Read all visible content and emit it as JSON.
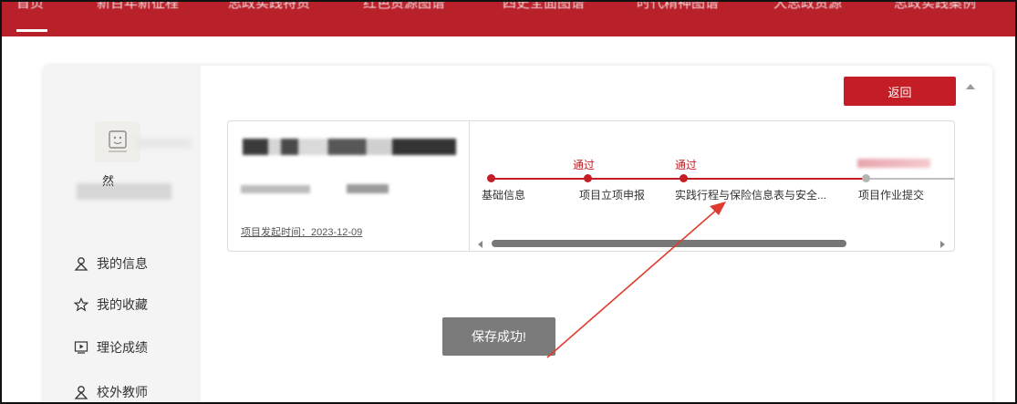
{
  "nav": {
    "items": [
      "首页",
      "新百年新征程",
      "思政实践特资",
      "红色资源图谱",
      "四史全面图谱",
      "时代精神图谱",
      "大思政资源",
      "思政实践案例"
    ]
  },
  "sidebar": {
    "username": "然",
    "items": [
      {
        "label": "我的信息",
        "icon": "user-icon"
      },
      {
        "label": "我的收藏",
        "icon": "star-icon"
      },
      {
        "label": "理论成绩",
        "icon": "play-icon"
      },
      {
        "label": "校外教师",
        "icon": "user-icon"
      }
    ]
  },
  "actions": {
    "back_label": "返回"
  },
  "project": {
    "start_date_label": "项目发起时间：2023-12-09",
    "steps": [
      {
        "label": "基础信息",
        "status": ""
      },
      {
        "label": "项目立项申报",
        "status": "通过"
      },
      {
        "label": "实践行程与保险信息表与安全...",
        "status": "通过"
      },
      {
        "label": "项目作业提交",
        "status": ""
      }
    ]
  },
  "toast": {
    "message": "保存成功!"
  },
  "colors": {
    "brand": "#c41d25",
    "nav_bg": "#b8202a",
    "toast_bg": "#7b7b7b"
  }
}
